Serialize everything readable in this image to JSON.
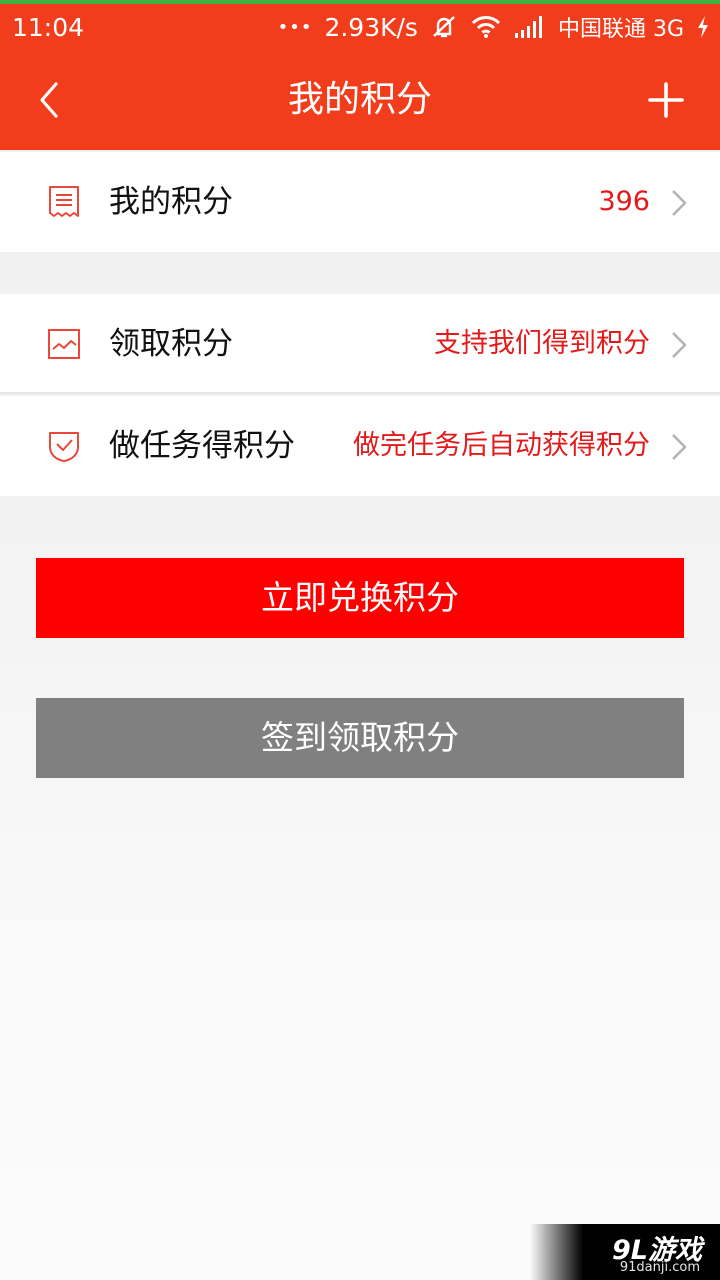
{
  "colors": {
    "accent": "#f13d1c",
    "value_red": "#e41a1a",
    "primary_button": "#ff0000",
    "secondary_button": "#808080"
  },
  "status_bar": {
    "time": "11:04",
    "dots": "•••",
    "speed": "2.93K/s",
    "carrier": "中国联通 3G",
    "icons": [
      "mute-icon",
      "wifi-icon",
      "signal-icon",
      "charging-icon"
    ]
  },
  "nav": {
    "back_icon": "chevron-left-icon",
    "title": "我的积分",
    "add_icon": "plus-icon"
  },
  "rows": [
    {
      "icon": "receipt-icon",
      "label": "我的积分",
      "value": "396"
    },
    {
      "icon": "chart-icon",
      "label": "领取积分",
      "value": "支持我们得到积分"
    },
    {
      "icon": "shield-check-icon",
      "label": "做任务得积分",
      "value": "做完任务后自动获得积分"
    }
  ],
  "buttons": {
    "exchange": "立即兑换积分",
    "checkin": "签到领取积分"
  },
  "watermark": {
    "logo": "9L游戏",
    "url": "91danji.com"
  }
}
